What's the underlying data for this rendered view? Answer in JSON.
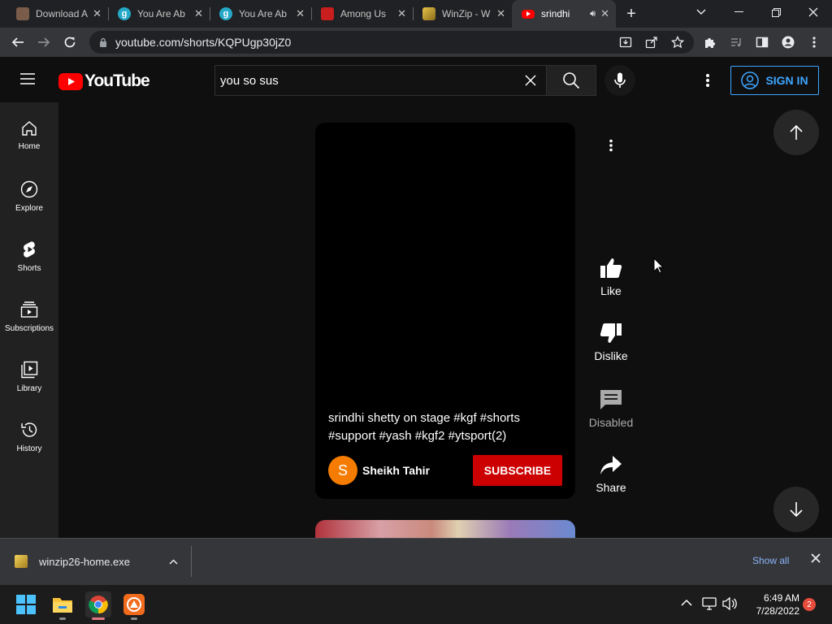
{
  "browser": {
    "tabs": [
      {
        "title": "Download A",
        "favicon": "download-favicon"
      },
      {
        "title": "You Are Ab",
        "favicon": "g-favicon"
      },
      {
        "title": "You Are Ab",
        "favicon": "g-favicon"
      },
      {
        "title": "Among Us",
        "favicon": "among-us-favicon"
      },
      {
        "title": "WinZip - W",
        "favicon": "winzip-favicon"
      },
      {
        "title": "srindhi",
        "favicon": "youtube-favicon",
        "active": true,
        "audio": true
      }
    ],
    "url": "youtube.com/shorts/KQPUgp30jZ0"
  },
  "youtube": {
    "logo_text": "YouTube",
    "search_value": "you so sus",
    "sign_in": "SIGN IN",
    "nav": [
      {
        "label": "Home",
        "icon": "home-icon"
      },
      {
        "label": "Explore",
        "icon": "compass-icon"
      },
      {
        "label": "Shorts",
        "icon": "shorts-icon"
      },
      {
        "label": "Subscriptions",
        "icon": "subscriptions-icon"
      },
      {
        "label": "Library",
        "icon": "library-icon"
      },
      {
        "label": "History",
        "icon": "history-icon"
      }
    ],
    "short": {
      "caption": "srindhi shetty on stage #kgf #shorts #support #yash #kgf2 #ytsport(2)",
      "channel": "Sheikh Tahir",
      "avatar_letter": "S",
      "subscribe": "SUBSCRIBE"
    },
    "actions": {
      "like": "Like",
      "dislike": "Dislike",
      "comments": "Disabled",
      "share": "Share"
    }
  },
  "download_shelf": {
    "file": "winzip26-home.exe",
    "show_all": "Show all"
  },
  "taskbar": {
    "time": "6:49 AM",
    "date": "7/28/2022",
    "notifications": "2"
  },
  "colors": {
    "accent_blue": "#3ea6ff",
    "subscribe_red": "#cc0000",
    "youtube_red": "#ff0000"
  }
}
